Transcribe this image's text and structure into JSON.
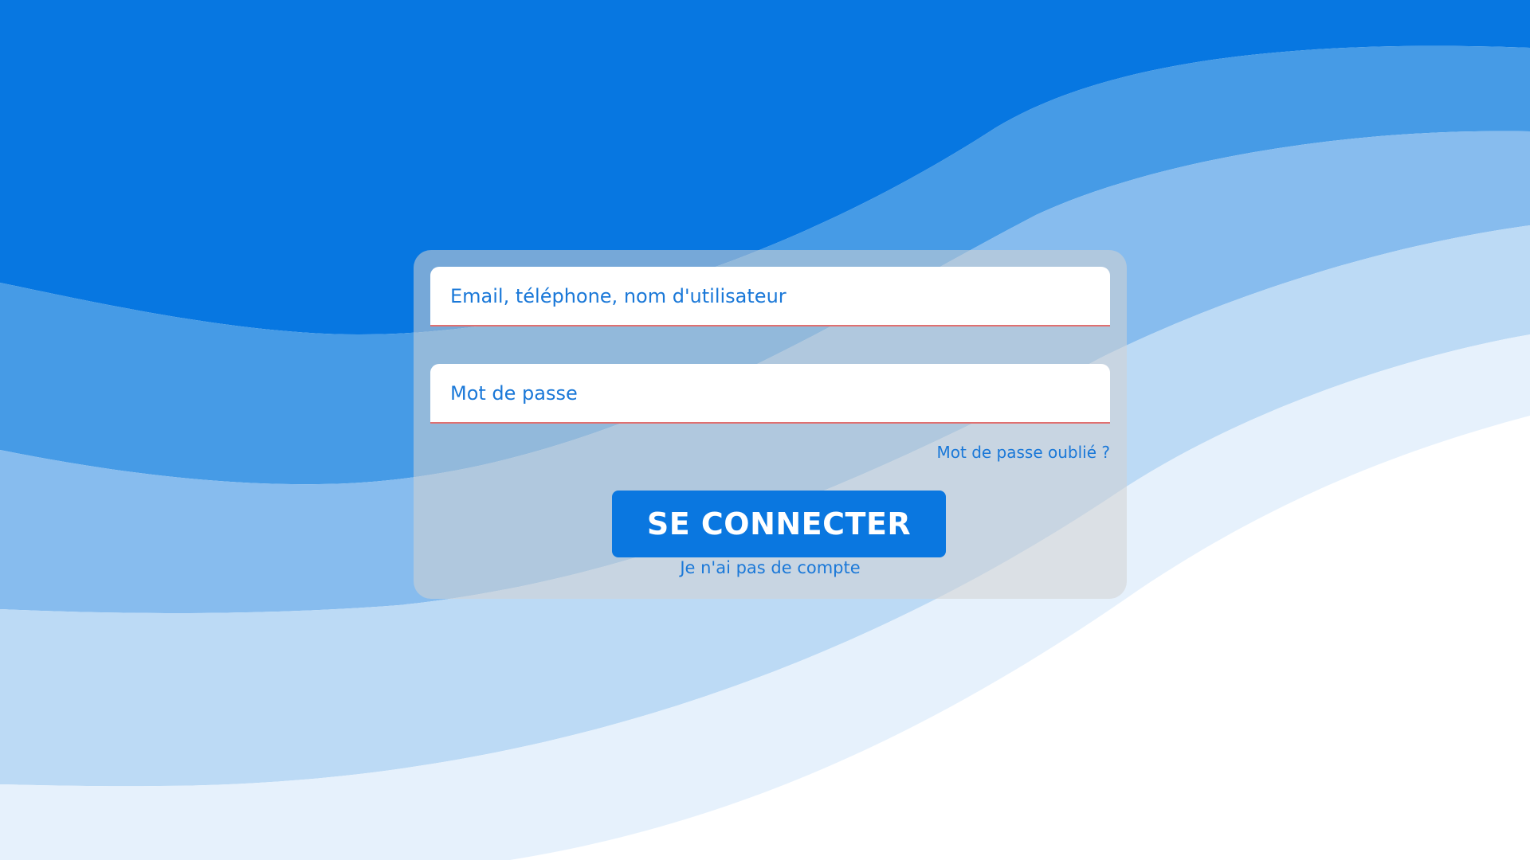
{
  "login": {
    "email_placeholder": "Email, téléphone, nom d'utilisateur",
    "password_placeholder": "Mot de passe",
    "forgot_password": "Mot de passe oublié ?",
    "submit_label": "SE CONNECTER",
    "no_account": "Je n'ai pas de compte"
  },
  "colors": {
    "primary": "#0a77e0",
    "wave_1": "#0777e1",
    "wave_2": "#469be6",
    "wave_3": "#87bcee",
    "wave_4": "#bcdaf5",
    "wave_5": "#e6f1fc",
    "field_underline": "#e07070"
  }
}
